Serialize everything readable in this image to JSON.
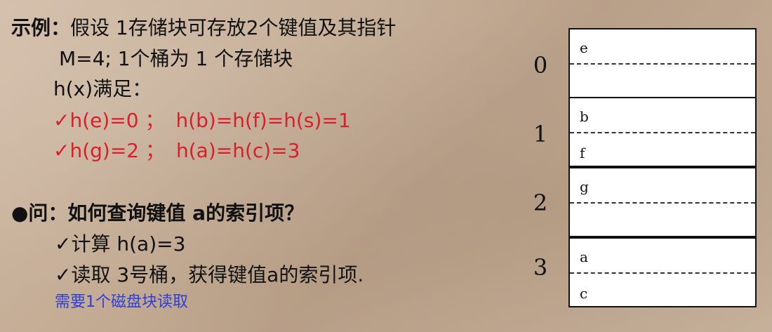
{
  "example": {
    "label": "示例：",
    "assumption": "假设 1存储块可存放2个键值及其指针",
    "m_line": "M=4; 1个桶为 1 个存储块",
    "h_line": "h(x)满足：",
    "hash_line1_a": "✓h(e)=0 ；",
    "hash_line1_b": "h(b)=h(f)=h(s)=1",
    "hash_line2_a": "✓h(g)=2 ；",
    "hash_line2_b": "h(a)=h(c)=3"
  },
  "question": {
    "title": "●问：如何查询键值 a的索引项？",
    "step1": "✓计算 h(a)=3",
    "step2": "✓读取 3号桶，获得键值a的索引项.",
    "note": "需要1个磁盘块读取"
  },
  "buckets": [
    {
      "index": "0",
      "slot1": "e",
      "slot2": ""
    },
    {
      "index": "1",
      "slot1": "b",
      "slot2": "f"
    },
    {
      "index": "2",
      "slot1": "g",
      "slot2": ""
    },
    {
      "index": "3",
      "slot1": "a",
      "slot2": "c"
    }
  ]
}
